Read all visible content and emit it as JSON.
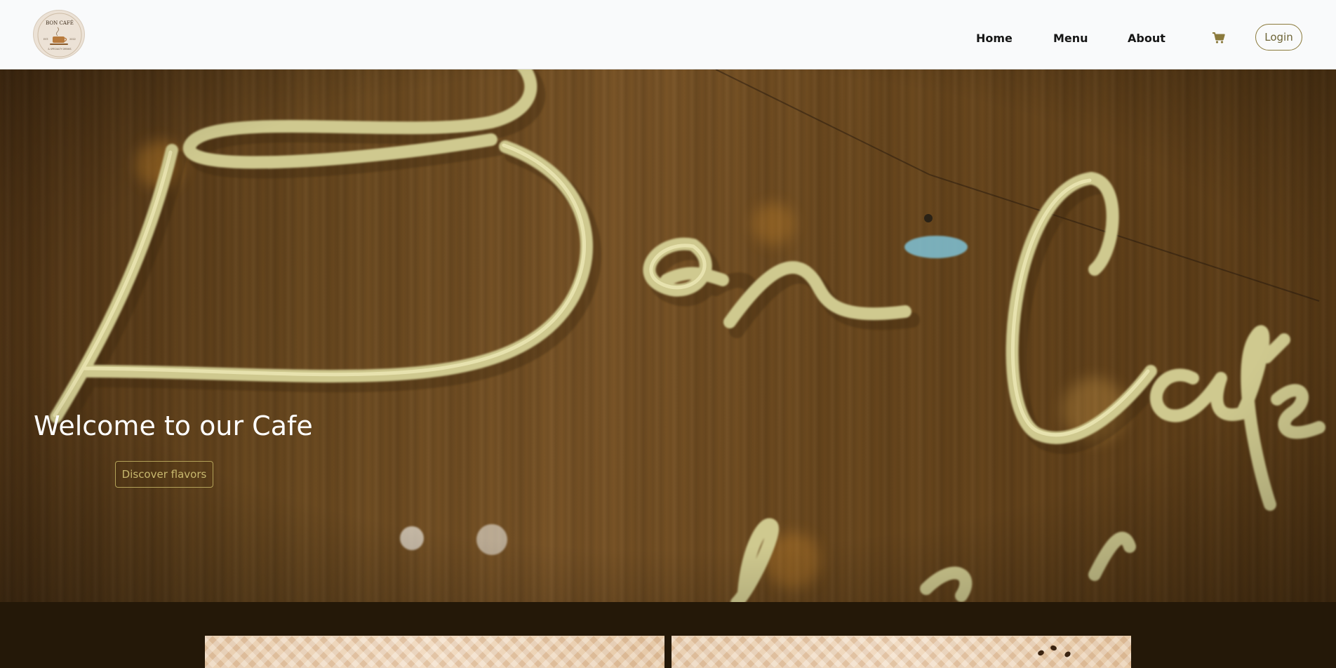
{
  "brand": {
    "logo_text": "BON CAFÉ",
    "logo_left": "EST.",
    "logo_right": "2022",
    "logo_bottom": "& SPECIALTY DRINKS"
  },
  "nav": {
    "items": [
      {
        "label": "Home"
      },
      {
        "label": "Menu"
      },
      {
        "label": "About"
      }
    ],
    "cart_icon": "cart-icon",
    "login_label": "Login"
  },
  "hero": {
    "title": "Welcome to our Cafe",
    "button_label": "Discover flavors",
    "sign_text": "Bon Café"
  },
  "colors": {
    "accent": "#8b7a3c",
    "nav_bg": "#f9fafb",
    "dark_band": "#241808",
    "neon": "#d7d29a"
  }
}
